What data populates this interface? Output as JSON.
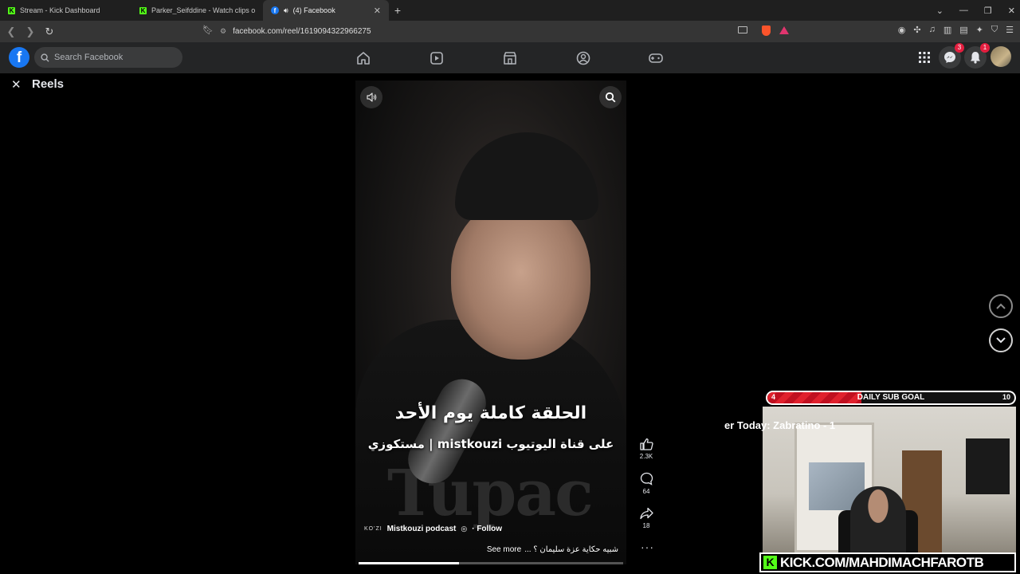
{
  "browser": {
    "tabs": [
      {
        "title": "Stream - Kick Dashboard",
        "favicon": "kick-icon",
        "active": false
      },
      {
        "title": "Parker_Seifddine - Watch clips on Kick",
        "favicon": "kick-icon",
        "active": false
      },
      {
        "title": "(4) Facebook",
        "favicon": "facebook-icon",
        "active": true,
        "audio": true
      }
    ],
    "url": "facebook.com/reel/1619094322966275"
  },
  "facebook": {
    "search_placeholder": "Search Facebook",
    "nav_icons": [
      "home-icon",
      "video-icon",
      "marketplace-icon",
      "groups-icon",
      "gaming-icon"
    ],
    "messenger_badge": "3",
    "notifications_badge": "1"
  },
  "reels": {
    "title": "Reels",
    "video": {
      "caption_main": "الحلقة كاملة يوم الأحد",
      "caption_sub": "على قناة اليوتيوب mistkouzi | مستكوزي",
      "shirt_text": "Tupac",
      "author_logo": "KO'ZI",
      "author": "Mistkouzi podcast",
      "follow_label": "· Follow",
      "description": "شبيه حكاية عزة سليمان ؟ ...",
      "see_more": "See more",
      "progress": 0.38
    },
    "actions": {
      "likes": "2.3K",
      "comments": "64",
      "shares": "18"
    }
  },
  "stream_overlay": {
    "goal_label": "DAILY SUB GOAL",
    "goal_current": "4",
    "goal_target": "10",
    "goal_progress": 0.38,
    "ticker": "er Today: Zabratino - 1",
    "kick_url": "KICK.COM/MAHDIMACHFAROTB",
    "accent": "#53fc18",
    "goal_color": "#e0212d"
  }
}
